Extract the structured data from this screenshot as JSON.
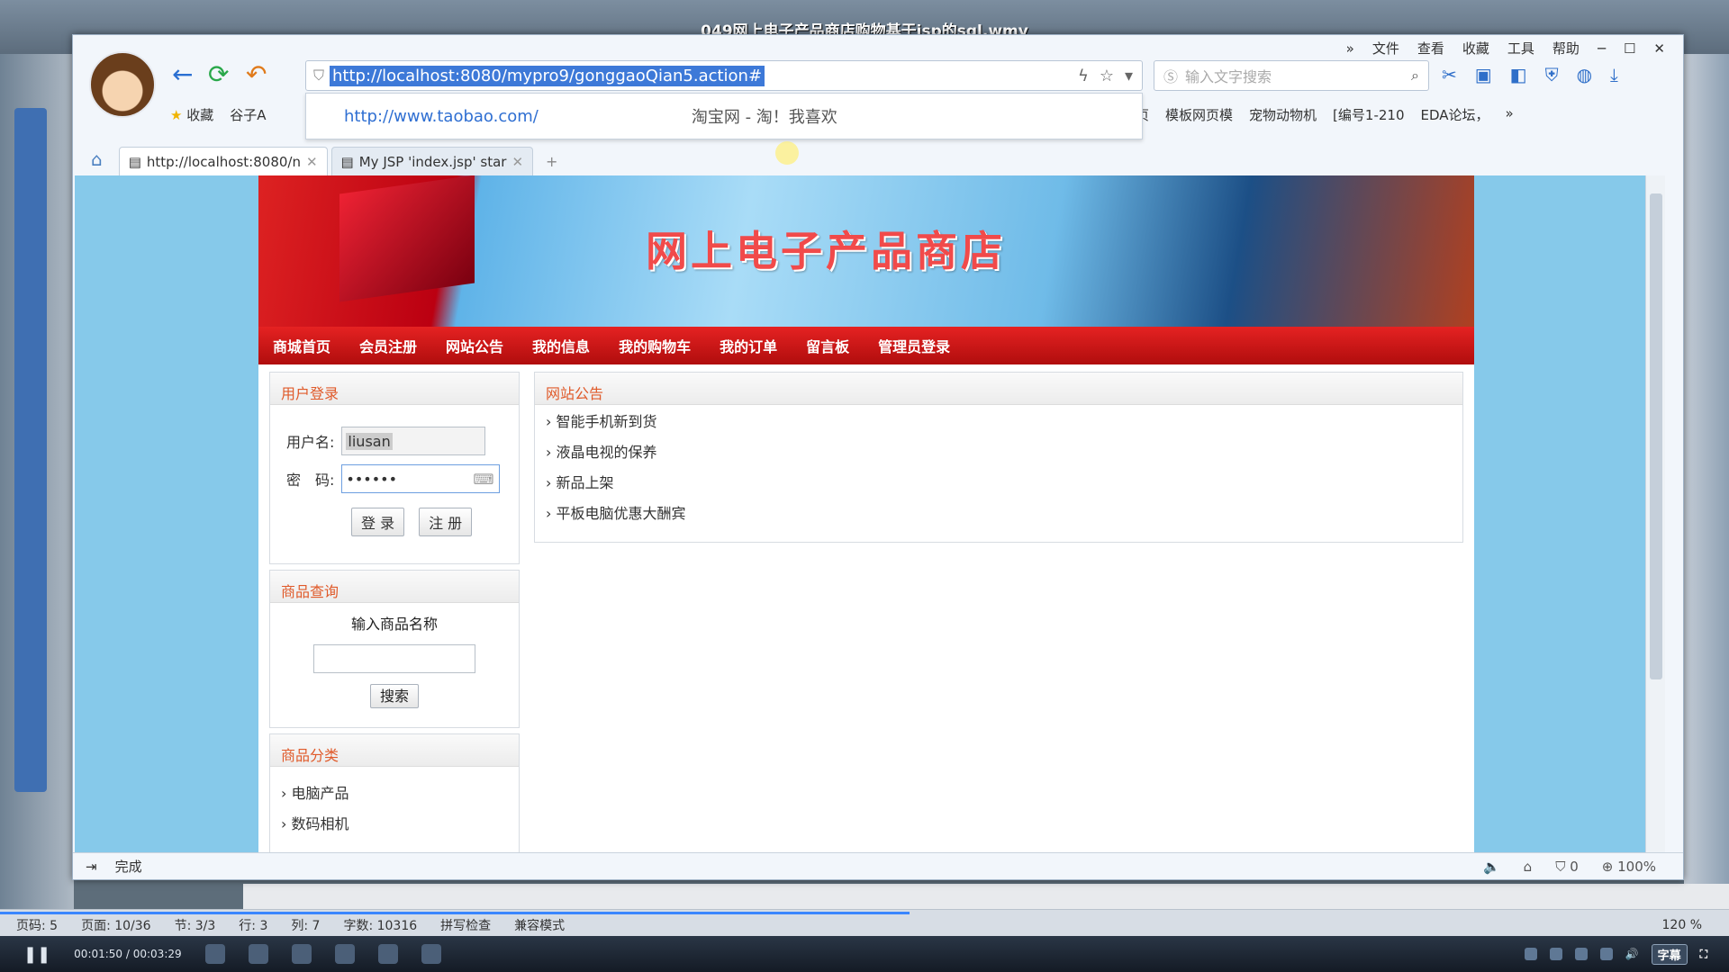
{
  "video": {
    "title": "049网上电子产品商店购物基于jsp的sql.wmv",
    "time": "00:01:50 / 00:03:29",
    "subtitle_btn": "字幕"
  },
  "word_status": {
    "page": "页码: 5",
    "pages": "页面: 10/36",
    "section": "节: 3/3",
    "line": "行: 3",
    "col": "列: 7",
    "words": "字数: 10316",
    "spell": "拼写检查",
    "mode": "兼容模式",
    "zoom": "120 %"
  },
  "browser": {
    "menu": [
      "»",
      "文件",
      "查看",
      "收藏",
      "工具",
      "帮助"
    ],
    "url": "http://localhost:8080/mypro9/gonggaoQian5.action#",
    "search_placeholder": "输入文字搜索",
    "bookmarks_left": [
      "收藏",
      "谷子A"
    ],
    "bookmarks_right": [
      "页",
      "模板网页模",
      "宠物动物机",
      "[编号1-210",
      "EDA论坛，"
    ],
    "suggest": {
      "url": "http://www.taobao.com/",
      "title": "淘宝网 - 淘！我喜欢"
    },
    "tabs": [
      {
        "label": "http://localhost:8080/n"
      },
      {
        "label": "My JSP 'index.jsp' star"
      }
    ],
    "status": {
      "text": "完成",
      "shield_count": "0",
      "zoom": "100%"
    }
  },
  "site": {
    "title": "网上电子产品商店",
    "nav": [
      "商城首页",
      "会员注册",
      "网站公告",
      "我的信息",
      "我的购物车",
      "我的订单",
      "留言板",
      "管理员登录"
    ],
    "login": {
      "heading": "用户登录",
      "username_label": "用户名:",
      "username_value": "liusan",
      "password_label": "密　码:",
      "password_value": "••••••",
      "login_btn": "登 录",
      "register_btn": "注 册"
    },
    "product_search": {
      "heading": "商品查询",
      "prompt": "输入商品名称",
      "button": "搜索"
    },
    "categories": {
      "heading": "商品分类",
      "items": [
        "电脑产品",
        "数码相机"
      ]
    },
    "notice": {
      "heading": "网站公告",
      "items": [
        "智能手机新到货",
        "液晶电视的保养",
        "新品上架",
        "平板电脑优惠大酬宾"
      ]
    }
  }
}
